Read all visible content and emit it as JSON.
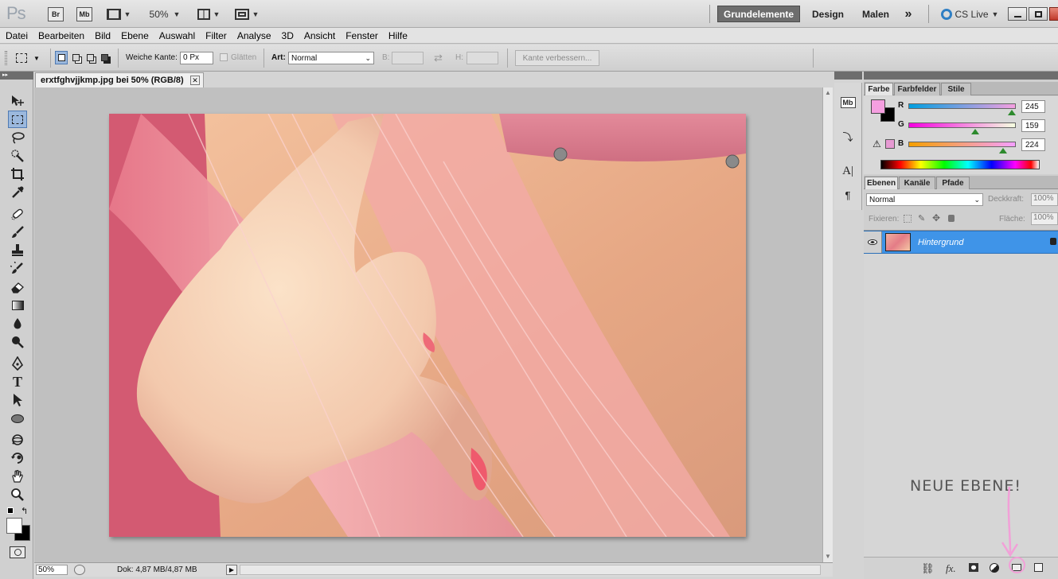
{
  "appbar": {
    "logo": "Ps",
    "bridge": "Br",
    "minibridge": "Mb",
    "zoom": "50%",
    "workspaces": [
      "Grundelemente",
      "Design",
      "Malen"
    ],
    "more": "»",
    "cslive": "CS Live"
  },
  "menu": [
    "Datei",
    "Bearbeiten",
    "Bild",
    "Ebene",
    "Auswahl",
    "Filter",
    "Analyse",
    "3D",
    "Ansicht",
    "Fenster",
    "Hilfe"
  ],
  "options": {
    "feather_label": "Weiche Kante:",
    "feather_value": "0 Px",
    "antialias_label": "Glätten",
    "style_label": "Art:",
    "style_value": "Normal",
    "width_label": "B:",
    "height_label": "H:",
    "refine_label": "Kante verbessern..."
  },
  "document": {
    "tab_title": "erxtfghvjjkmp.jpg bei 50% (RGB/8)",
    "close": "✕"
  },
  "status": {
    "zoom": "50%",
    "doc_info": "Dok: 4,87 MB/4,87 MB"
  },
  "color_panel": {
    "tabs": [
      "Farbe",
      "Farbfelder",
      "Stile"
    ],
    "channels": [
      {
        "label": "R",
        "value": "245",
        "level": 0.96
      },
      {
        "label": "G",
        "value": "159",
        "level": 0.62
      },
      {
        "label": "B",
        "value": "224",
        "level": 0.88
      }
    ],
    "fg_color": "#f59fe0",
    "bg_color": "#000000"
  },
  "layers_panel": {
    "tabs": [
      "Ebenen",
      "Kanäle",
      "Pfade"
    ],
    "blend_mode": "Normal",
    "opacity_label": "Deckkraft:",
    "opacity_value": "100%",
    "lock_label": "Fixieren:",
    "fill_label": "Fläche:",
    "fill_value": "100%",
    "layers": [
      {
        "name": "Hintergrund",
        "selected": true,
        "locked": true
      }
    ]
  },
  "annotation": {
    "text": "NEUE EBENE!",
    "color": "#f2a0d8"
  },
  "accent": "#3f94e8"
}
